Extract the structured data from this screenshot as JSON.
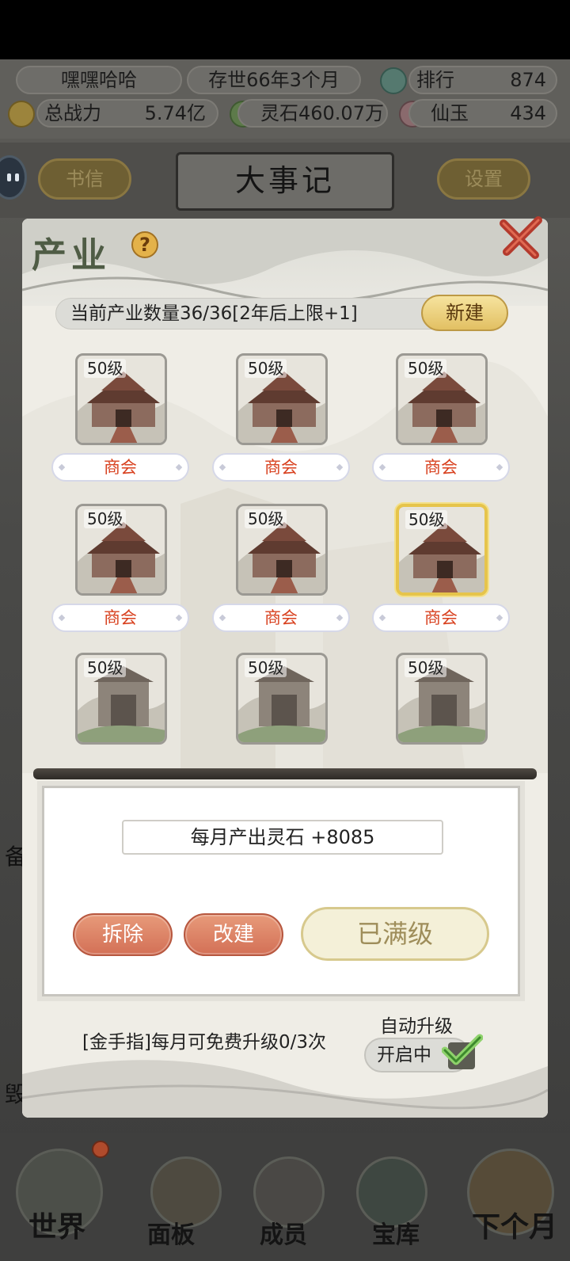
{
  "top": {
    "player_name": "嘿嘿哈哈",
    "age": "存世66年3个月",
    "rank_label": "排行",
    "rank_value": "874",
    "power_label": "总战力",
    "power_value": "5.74亿",
    "spirit_stone": "灵石460.07万",
    "jade_label": "仙玉",
    "jade_value": "434"
  },
  "nav": {
    "letters": "书信",
    "title": "大事记",
    "settings": "设置"
  },
  "dialog": {
    "title": "产业",
    "help": "?",
    "count_text": "当前产业数量36/36[2年后上限+1]",
    "new_button": "新建",
    "tiles": [
      {
        "level": "50级",
        "name": "商会"
      },
      {
        "level": "50级",
        "name": "商会"
      },
      {
        "level": "50级",
        "name": "商会"
      },
      {
        "level": "50级",
        "name": "商会"
      },
      {
        "level": "50级",
        "name": "商会"
      },
      {
        "level": "50级",
        "name": "商会"
      },
      {
        "level": "50级",
        "name": ""
      },
      {
        "level": "50级",
        "name": ""
      },
      {
        "level": "50级",
        "name": ""
      }
    ],
    "output_text": "每月产出灵石 +8085",
    "demolish_button": "拆除",
    "rebuild_button": "改建",
    "max_button": "已满级",
    "free_upgrade_text": "[金手指]每月可免费升级0/3次",
    "auto_upgrade_label": "自动升级",
    "auto_upgrade_state": "开启中"
  },
  "bottom_nav": {
    "world": "世界",
    "panel": "面板",
    "members": "成员",
    "treasury": "宝库",
    "next_month": "下个月"
  },
  "side_fragments": {
    "left1": "备",
    "left2": "毁"
  }
}
